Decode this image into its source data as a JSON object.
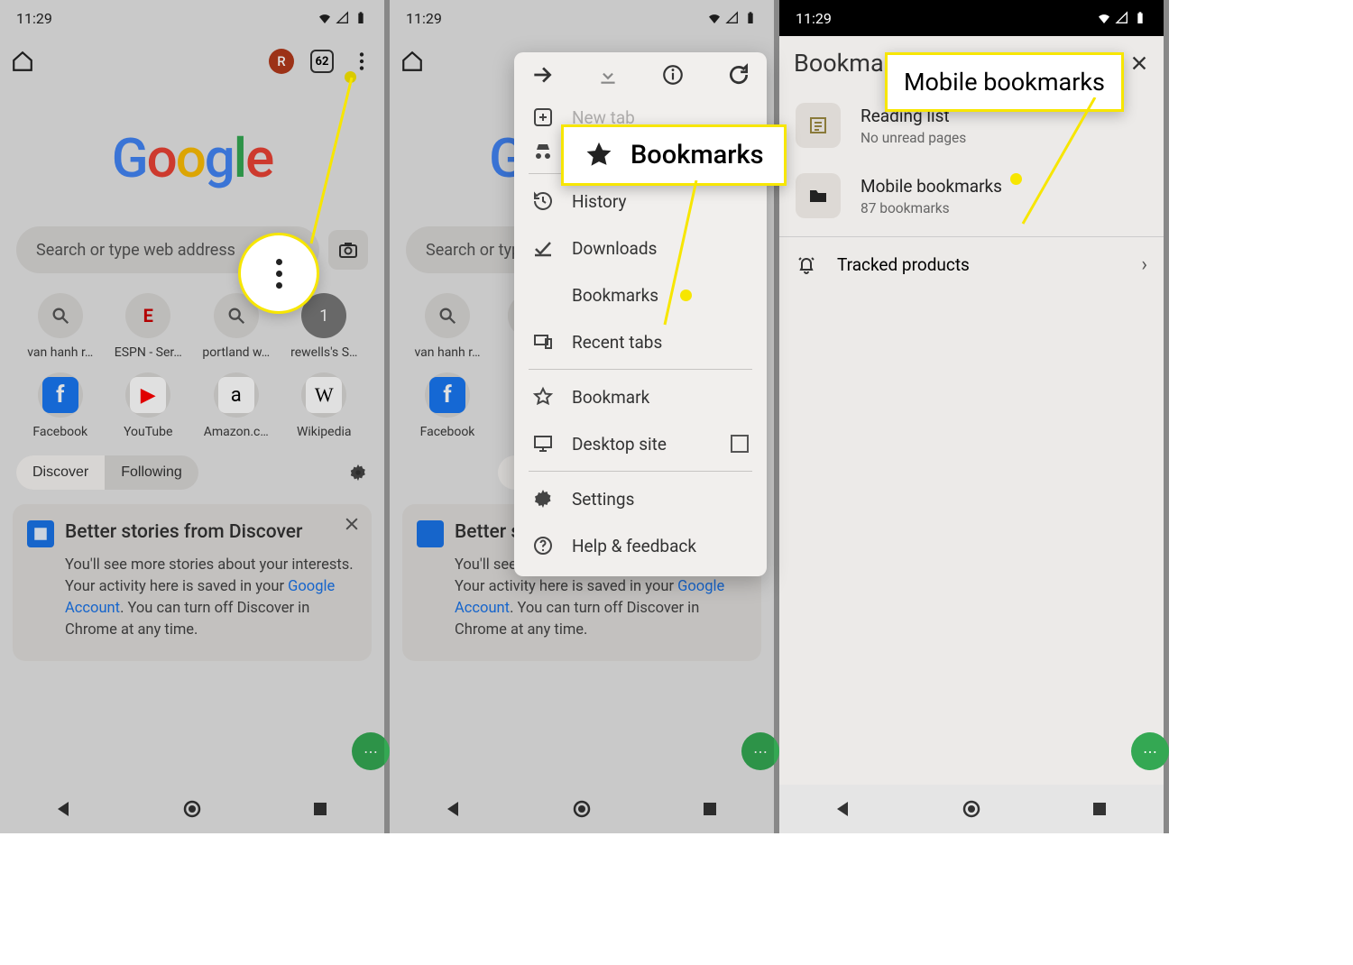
{
  "status": {
    "time": "11:29"
  },
  "topbar": {
    "avatar_initial": "R",
    "tab_count": "62"
  },
  "search": {
    "placeholder": "Search or type web address"
  },
  "shortcuts": [
    {
      "label": "van hanh r…",
      "kind": "search"
    },
    {
      "label": "ESPN - Ser…",
      "kind": "espn",
      "text": "E"
    },
    {
      "label": "portland w…",
      "kind": "search"
    },
    {
      "label": "rewells's S…",
      "kind": "num",
      "text": "1"
    },
    {
      "label": "Facebook",
      "kind": "fb",
      "text": "f"
    },
    {
      "label": "YouTube",
      "kind": "yt",
      "text": "▶"
    },
    {
      "label": "Amazon.c…",
      "kind": "amz",
      "text": "a"
    },
    {
      "label": "Wikipedia",
      "kind": "wiki",
      "text": "W"
    }
  ],
  "feed_tabs": {
    "discover": "Discover",
    "following": "Following"
  },
  "card": {
    "title": "Better stories from Discover",
    "body_pre": "You'll see more stories about your interests. Your activity here is saved in your ",
    "link": "Google Account",
    "body_post": ". You can turn off Discover in Chrome at any time."
  },
  "menu": {
    "new_tab": "New tab",
    "history": "History",
    "downloads": "Downloads",
    "bookmarks": "Bookmarks",
    "recent_tabs": "Recent tabs",
    "bookmark": "Bookmark",
    "desktop": "Desktop site",
    "settings": "Settings",
    "help": "Help & feedback"
  },
  "callouts": {
    "bookmarks": "Bookmarks",
    "mobile": "Mobile bookmarks"
  },
  "bm_page": {
    "title": "Bookmarks",
    "reading_title": "Reading list",
    "reading_sub": "No unread pages",
    "mobile_title": "Mobile bookmarks",
    "mobile_sub": "87 bookmarks",
    "tracked": "Tracked products"
  }
}
